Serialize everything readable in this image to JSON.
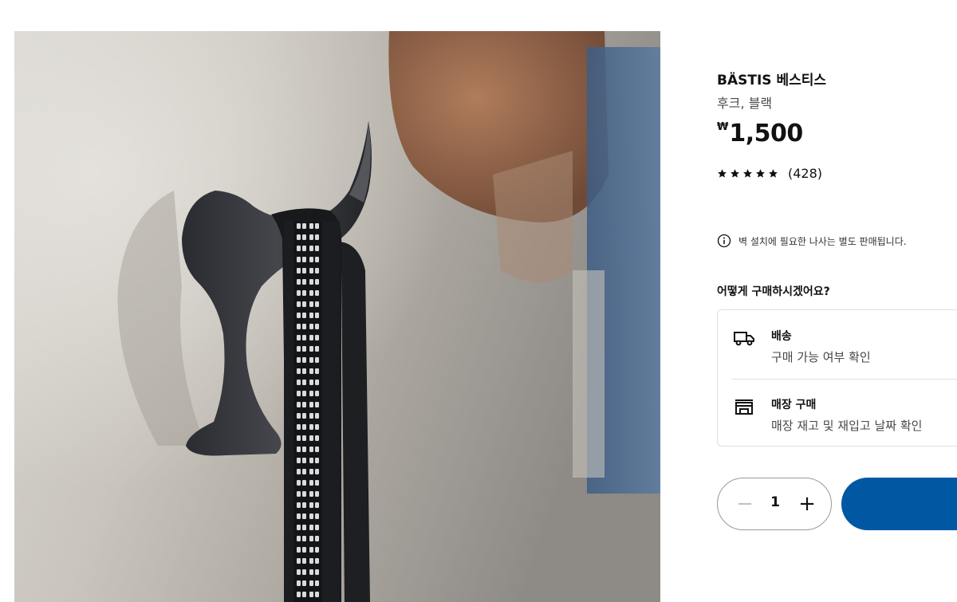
{
  "product": {
    "name": "BÄSTIS 베스티스",
    "description": "후크, 블랙",
    "price_currency": "₩",
    "price_amount": "1,500",
    "rating": 5,
    "review_count": "(428)"
  },
  "notice": {
    "icon": "info-icon",
    "text": "벽 설치에 필요한 나사는 별도 판매됩니다."
  },
  "purchase": {
    "heading": "어떻게 구매하시겠어요?",
    "options": [
      {
        "icon": "truck-icon",
        "label": "배송",
        "sub": "구매 가능 여부 확인"
      },
      {
        "icon": "store-icon",
        "label": "매장 구매",
        "sub": "매장 재고 및 재입고 날짜 확인"
      }
    ]
  },
  "quantity": {
    "value": "1",
    "minus": "−",
    "plus": "+"
  },
  "colors": {
    "accent": "#0058a3",
    "text": "#111111",
    "muted": "#484848",
    "border": "#dfdfdf"
  }
}
